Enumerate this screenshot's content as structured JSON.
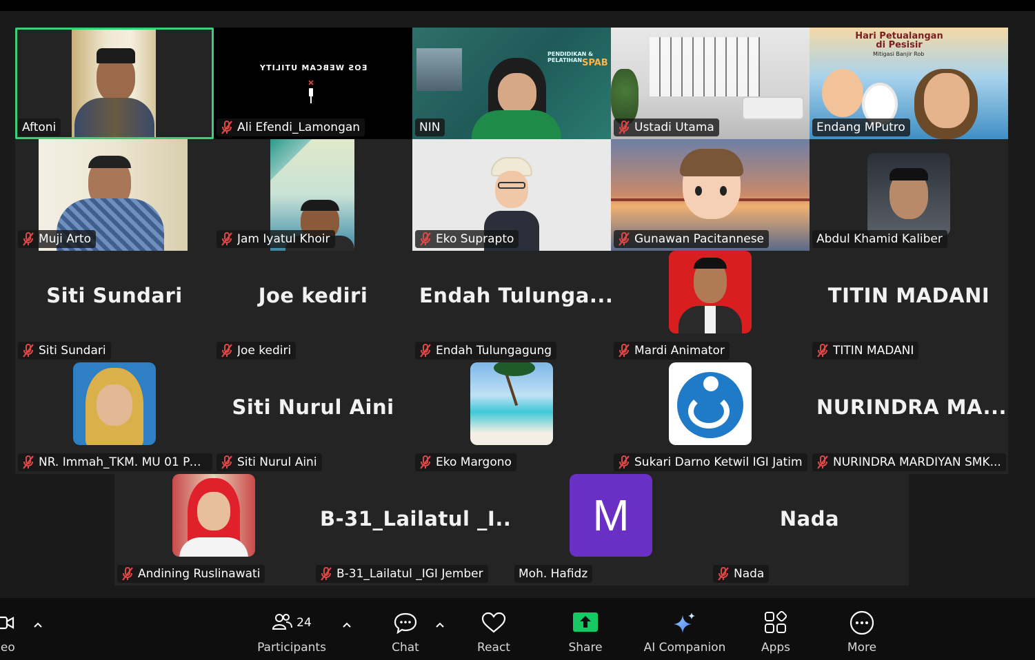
{
  "tiles": [
    {
      "name": "Aftoni",
      "muted": false,
      "kind": "photo-man1",
      "active": true
    },
    {
      "name": "Ali Efendi_Lamongan",
      "muted": true,
      "kind": "eos",
      "overlay": "EOS WEBCAM UTILITY"
    },
    {
      "name": "NIN",
      "muted": false,
      "kind": "nin",
      "slide_title": "PENDIDIKAN & PELATIHAN",
      "slide_sub": "SPAB"
    },
    {
      "name": "Ustadi Utama",
      "muted": true,
      "kind": "room"
    },
    {
      "name": "Endang MPutro",
      "muted": false,
      "kind": "cartoon",
      "poster_title": "Hari Petualangan di Pesisir",
      "poster_sub": "Mitigasi Banjir Rob"
    },
    {
      "name": "Muji Arto",
      "muted": true,
      "kind": "photo-man2"
    },
    {
      "name": "Jam Iyatul Khoir",
      "muted": true,
      "kind": "photo-man3"
    },
    {
      "name": "Eko Suprapto",
      "muted": true,
      "kind": "avatar-hat"
    },
    {
      "name": "Gunawan Pacitannese",
      "muted": true,
      "kind": "avatar-bridge"
    },
    {
      "name": "Abdul Khamid Kaliber",
      "muted": false,
      "kind": "photo-man4"
    },
    {
      "name": "Siti Sundari",
      "muted": true,
      "kind": "text",
      "display": "Siti Sundari"
    },
    {
      "name": "Joe kediri",
      "muted": true,
      "kind": "text",
      "display": "Joe kediri"
    },
    {
      "name": "Endah Tulungagung",
      "muted": true,
      "kind": "text",
      "display": "Endah  Tulunga..."
    },
    {
      "name": "Mardi Animator",
      "muted": true,
      "kind": "red-portrait"
    },
    {
      "name": "TITIN MADANI",
      "muted": true,
      "kind": "text",
      "display": "TITIN MADANI"
    },
    {
      "name": "NR. Immah_TKM. MU 01 Pac...",
      "muted": true,
      "kind": "hijab-yellow"
    },
    {
      "name": "Siti Nurul Aini",
      "muted": true,
      "kind": "text",
      "display": "Siti Nurul Aini"
    },
    {
      "name": "Eko Margono",
      "muted": true,
      "kind": "beach"
    },
    {
      "name": "Sukari Darno Ketwil IGI Jatim",
      "muted": true,
      "kind": "logo-blue"
    },
    {
      "name": "NURINDRA MARDIYAN SMK...",
      "muted": true,
      "kind": "text",
      "display": "NURINDRA  MA..."
    },
    {
      "name": "Andining Ruslinawati",
      "muted": true,
      "kind": "hijab-red"
    },
    {
      "name": "B-31_Lailatul _IGI Jember",
      "muted": true,
      "kind": "text",
      "display": "B-31_Lailatul  _I..."
    },
    {
      "name": "Moh. Hafidz",
      "muted": false,
      "kind": "letter",
      "letter": "M"
    },
    {
      "name": "Nada",
      "muted": true,
      "kind": "text",
      "display": "Nada"
    }
  ],
  "toolbar": {
    "video_label": "leo",
    "participants_label": "Participants",
    "participants_count": "24",
    "chat_label": "Chat",
    "react_label": "React",
    "share_label": "Share",
    "ai_label": "AI Companion",
    "apps_label": "Apps",
    "more_label": "More"
  },
  "colors": {
    "active_border": "#3ccf7a",
    "share_green": "#17c964",
    "muted_red": "#e04848",
    "letter_purple": "#6a2fc4"
  }
}
